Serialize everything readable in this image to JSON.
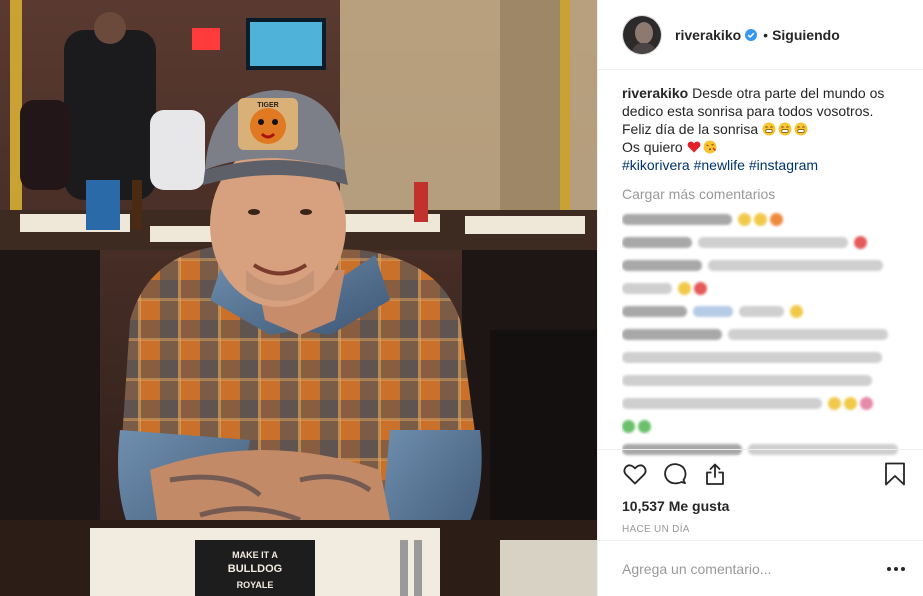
{
  "post": {
    "username": "riverakiko",
    "follow_status": "Siguiendo",
    "dot": "•",
    "verified_icon": "verified-badge-icon",
    "caption": {
      "username": "riverakiko",
      "line1": "Desde otra parte del mundo os dedico esta sonrisa para todos vosotros.",
      "line2": "Feliz día de la sonrisa",
      "line3": "Os quiero",
      "hashtags": "#kikorivera #newlife #instagram"
    },
    "load_more": "Cargar más comentarios",
    "likes": "10,537 Me gusta",
    "timestamp": "HACE UN DÍA",
    "comment_placeholder": "Agrega un comentario...",
    "icons": {
      "like": "heart-icon",
      "comment": "comment-bubble-icon",
      "share": "share-icon",
      "save": "bookmark-icon",
      "more": "more-options-icon"
    },
    "colors": {
      "text": "#262626",
      "muted": "#999999",
      "hashtag": "#003569",
      "verified": "#3897f0",
      "heart": "#ed4956"
    }
  },
  "photo": {
    "cap_badge_text": "TIGER",
    "menu_text_1": "MAKE IT A",
    "menu_text_2": "BULLDOG",
    "menu_text_3": "ROYALE"
  }
}
